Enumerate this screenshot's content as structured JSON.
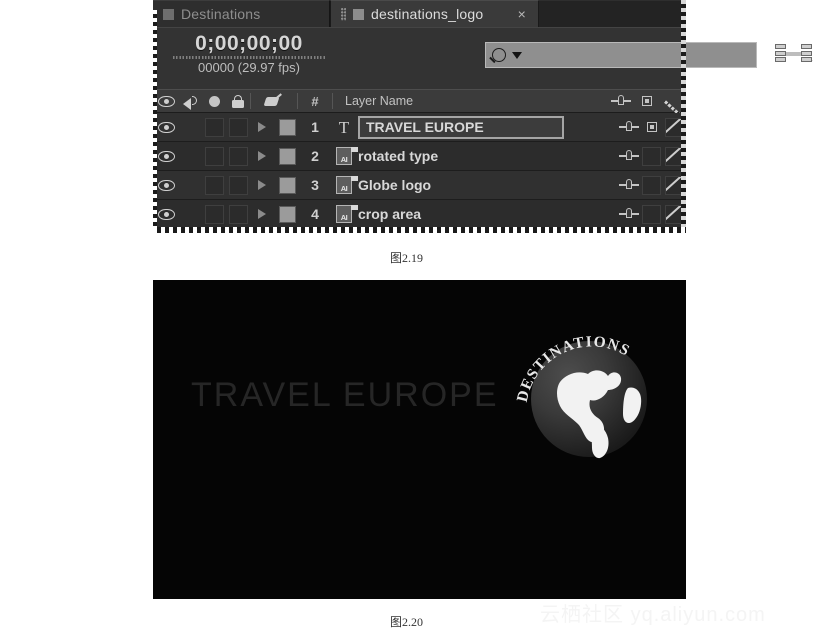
{
  "figures": [
    {
      "caption": "图2.19"
    },
    {
      "caption": "图2.20"
    }
  ],
  "ae_panel": {
    "tabs": [
      {
        "label": "Destinations",
        "active": false,
        "closable": false
      },
      {
        "label": "destinations_logo",
        "active": true,
        "closable": true,
        "close_glyph": "×"
      }
    ],
    "timecode": {
      "current": "0;00;00;00",
      "frames_and_rate": "00000 (29.97 fps)"
    },
    "search": {
      "value": "",
      "placeholder": "",
      "icon": "search-icon",
      "dropdown_icon": "caret-down-icon"
    },
    "toolbar_right": {
      "icon": "composition-mini-flowchart-icon"
    },
    "columns": {
      "video_icon": "eye-icon",
      "audio_icon": "speaker-icon",
      "solo_icon": "solo-circle-icon",
      "lock_icon": "lock-icon",
      "label_icon": "label-tag-icon",
      "number_header": "#",
      "layer_name_header": "Layer Name",
      "parent_icon": "parent-pickwhip-icon",
      "quality_icon": "quality-switch-icon",
      "motion_blur_icon": "motion-blur-icon"
    },
    "layers": [
      {
        "number": "1",
        "name": "TRAVEL EUROPE",
        "type_icon": "text-layer-icon",
        "type_glyph": "T",
        "name_editing": true,
        "visible": true,
        "has_quality_switch": true
      },
      {
        "number": "2",
        "name": "rotated type",
        "type_icon": "illustrator-file-icon",
        "type_glyph": "AI",
        "name_editing": false,
        "visible": true,
        "has_quality_switch": false
      },
      {
        "number": "3",
        "name": "Globe logo",
        "type_icon": "illustrator-file-icon",
        "type_glyph": "AI",
        "name_editing": false,
        "visible": true,
        "has_quality_switch": false
      },
      {
        "number": "4",
        "name": "crop area",
        "type_icon": "illustrator-file-icon",
        "type_glyph": "AI",
        "name_editing": false,
        "visible": true,
        "has_quality_switch": false
      }
    ]
  },
  "preview": {
    "headline": "TRAVEL EUROPE",
    "globe_ring_text": "DESTINATIONS",
    "background_color": "#050505",
    "headline_color": "#262626"
  },
  "watermark": {
    "site_cn": "云栖社区",
    "site_url": "yq.aliyun.com"
  }
}
